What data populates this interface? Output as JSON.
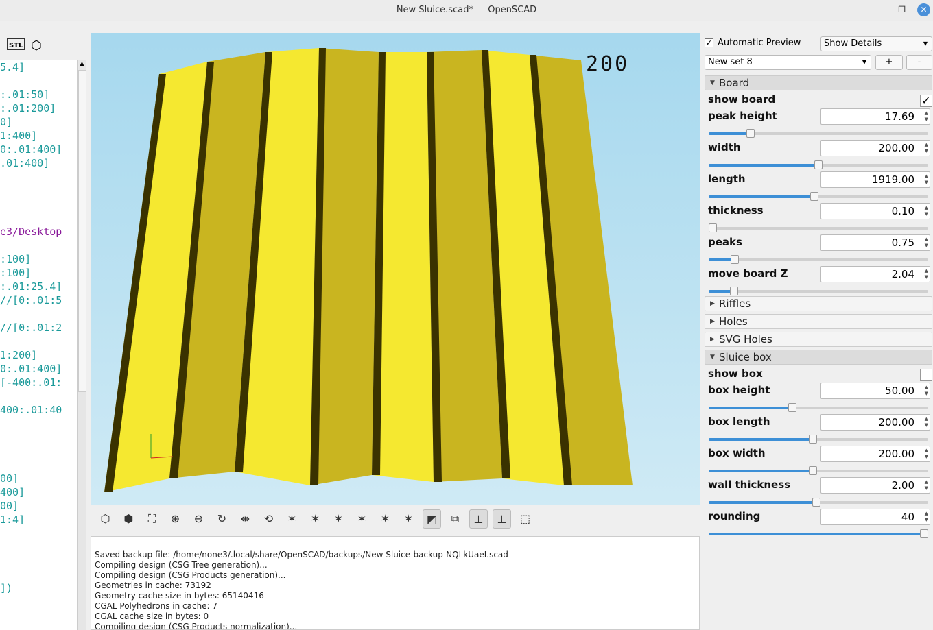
{
  "window": {
    "title": "New Sluice.scad* — OpenSCAD"
  },
  "editor": {
    "lines": [
      "5.4]",
      "",
      ":.01:50]",
      ":.01:200]",
      "0]",
      "1:400]",
      "0:.01:400]",
      ".01:400]",
      "",
      "",
      "",
      "",
      "e3/Desktop",
      "",
      ":100]",
      ":100]",
      ":.01:25.4]",
      "//[0:.01:5",
      "",
      "//[0:.01:2",
      "",
      "1:200]",
      "0:.01:400]",
      "[-400:.01:",
      "",
      "400:.01:40",
      "",
      "",
      "",
      "",
      "00]",
      "400]",
      "00]",
      "1:4]",
      "",
      "",
      "",
      "",
      "])"
    ],
    "purple_line": 12,
    "black_line": 37
  },
  "viewport": {
    "axis_label": "200",
    "bg_color": "#a6d8ee",
    "model_color": "#f5e830"
  },
  "view_toolbar": [
    "preview",
    "render",
    "view-all",
    "zoom-in",
    "zoom-out",
    "reset-view",
    "view-perspective-toggle",
    "rotate",
    "right",
    "left",
    "back",
    "front",
    "top",
    "bottom",
    "perspective",
    "orthogonal",
    "show-axes",
    "show-scale-markers",
    "show-edges"
  ],
  "console": {
    "lines": [
      "Saved backup file: /home/none3/.local/share/OpenSCAD/backups/New Sluice-backup-NQLkUaeI.scad",
      "Compiling design (CSG Tree generation)...",
      "Compiling design (CSG Products generation)...",
      "Geometries in cache: 73192",
      "Geometry cache size in bytes: 65140416",
      "CGAL Polyhedrons in cache: 7",
      "CGAL cache size in bytes: 0",
      "Compiling design (CSG Products normalization)..."
    ]
  },
  "customizer": {
    "auto_preview_label": "Automatic Preview",
    "auto_preview": true,
    "details_select": "Show Details",
    "preset": "New set 8",
    "add": "+",
    "remove": "-",
    "sections": {
      "board": "Board",
      "riffles": "Riffles",
      "holes": "Holes",
      "svg_holes": "SVG Holes",
      "sluice_box": "Sluice box"
    },
    "board": [
      {
        "label": "show board",
        "type": "checkbox",
        "checked": true
      },
      {
        "label": "peak height",
        "value": "17.69",
        "slider": 0.19
      },
      {
        "label": "width",
        "value": "200.00",
        "slider": 0.5
      },
      {
        "label": "length",
        "value": "1919.00",
        "slider": 0.48
      },
      {
        "label": "thickness",
        "value": "0.10",
        "slider": 0.02
      },
      {
        "label": "peaks",
        "value": "0.75",
        "slider": 0.12
      },
      {
        "label": "move board Z",
        "value": "2.04",
        "slider": 0.115
      }
    ],
    "box": [
      {
        "label": "show box",
        "type": "checkbox",
        "checked": false
      },
      {
        "label": "box height",
        "value": "50.00",
        "slider": 0.38
      },
      {
        "label": "box length",
        "value": "200.00",
        "slider": 0.475
      },
      {
        "label": "box width",
        "value": "200.00",
        "slider": 0.475
      },
      {
        "label": "wall thickness",
        "value": "2.00",
        "slider": 0.49
      },
      {
        "label": "rounding",
        "value": "40",
        "slider": 0.98
      }
    ]
  }
}
